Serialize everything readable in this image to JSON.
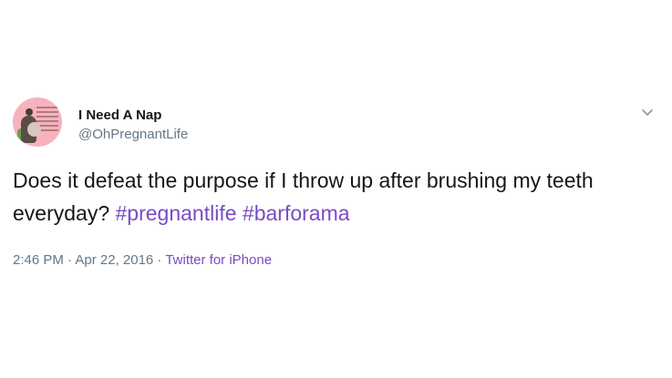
{
  "tweet": {
    "display_name": "I Need A Nap",
    "handle": "@OhPregnantLife",
    "text_before": "Does it defeat the purpose if I throw up after brushing my teeth everyday? ",
    "hashtag_1": "#pregnantlife",
    "hashtag_2": "#barforama",
    "timestamp": "2:46 PM · Apr 22, 2016",
    "separator": " · ",
    "source": "Twitter for iPhone"
  },
  "icons": {
    "caret": "chevron-down-icon",
    "avatar": "profile-avatar"
  },
  "colors": {
    "accent": "#794bc4",
    "text": "#14171a",
    "secondary": "#657786",
    "avatar_bg": "#f6b3bd"
  }
}
